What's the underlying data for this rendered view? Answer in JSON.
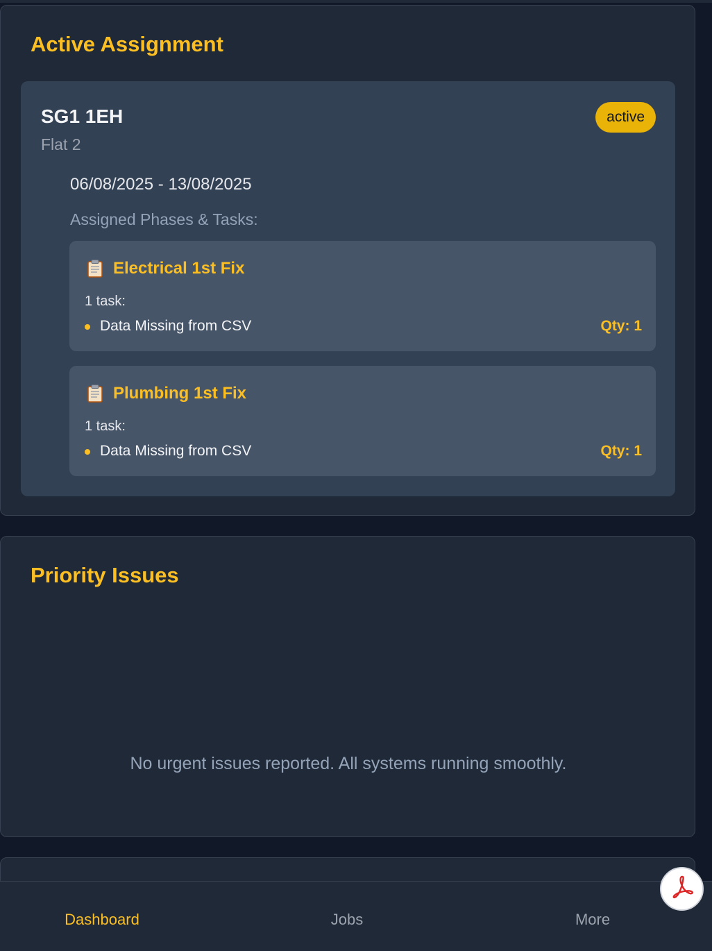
{
  "active_assignment": {
    "title": "Active Assignment",
    "postcode": "SG1 1EH",
    "unit": "Flat 2",
    "status": "active",
    "date_range": "06/08/2025 - 13/08/2025",
    "phases_heading": "Assigned Phases & Tasks:",
    "phases": [
      {
        "icon": "clipboard-icon",
        "name": "Electrical 1st Fix",
        "task_count": "1 task:",
        "tasks": [
          {
            "name": "Data Missing from CSV",
            "qty": "Qty: 1"
          }
        ]
      },
      {
        "icon": "clipboard-icon",
        "name": "Plumbing 1st Fix",
        "task_count": "1 task:",
        "tasks": [
          {
            "name": "Data Missing from CSV",
            "qty": "Qty: 1"
          }
        ]
      }
    ]
  },
  "priority_issues": {
    "title": "Priority Issues",
    "empty_message": "No urgent issues reported. All systems running smoothly."
  },
  "bottom_nav": {
    "items": [
      {
        "label": "Dashboard",
        "active": true
      },
      {
        "label": "Jobs",
        "active": false
      },
      {
        "label": "More",
        "active": false
      }
    ]
  },
  "fab": {
    "icon": "pdf-icon"
  },
  "colors": {
    "accent": "#fbbf24",
    "background": "#111827",
    "card": "#1f2937",
    "badge": "#eab308"
  }
}
